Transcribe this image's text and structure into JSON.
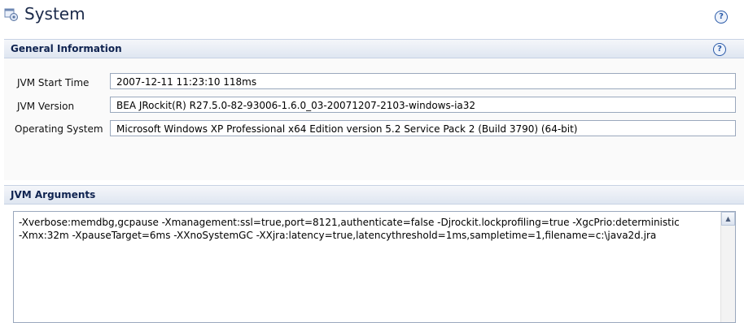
{
  "title": "System",
  "help_glyph": "?",
  "sections": {
    "general": {
      "title": "General Information",
      "rows": [
        {
          "label": "JVM Start Time",
          "value": "2007-12-11 11:23:10 118ms"
        },
        {
          "label": "JVM Version",
          "value": "BEA JRockit(R) R27.5.0-82-93006-1.6.0_03-20071207-2103-windows-ia32"
        },
        {
          "label": "Operating System",
          "value": "Microsoft Windows XP Professional x64 Edition version 5.2 Service Pack 2 (Build 3790) (64-bit)"
        }
      ]
    },
    "jvm_args": {
      "title": "JVM Arguments",
      "line1": "-Xverbose:memdbg,gcpause -Xmanagement:ssl=true,port=8121,authenticate=false -Djrockit.lockprofiling=true -XgcPrio:deterministic",
      "line2": "-Xmx:32m -XpauseTarget=6ms -XXnoSystemGC -XXjra:latency=true,latencythreshold=1ms,sampletime=1,filename=c:\\java2d.jra"
    }
  },
  "icons": {
    "title": "system-icon",
    "help": "help-icon",
    "scroll_up": "scroll-up-arrow"
  }
}
